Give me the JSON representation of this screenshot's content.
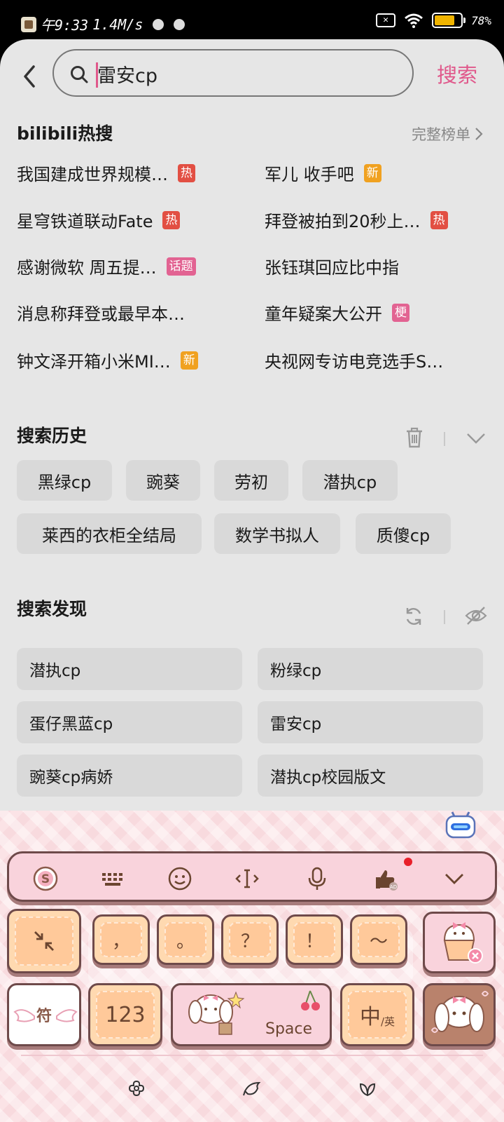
{
  "status_bar": {
    "time": "午9:33",
    "speed": "1.4M/s",
    "battery": "78%",
    "battery_level": 0.78
  },
  "header": {
    "back_icon": "back-arrow-icon",
    "search_icon": "search-icon",
    "search_value": "雷安cp",
    "search_button": "搜索"
  },
  "hot_search": {
    "title": "bilibili热搜",
    "more_label": "完整榜单",
    "items": [
      {
        "text": "我国建成世界规模…",
        "badge": "热",
        "badge_type": "hot"
      },
      {
        "text": "军儿 收手吧",
        "badge": "新",
        "badge_type": "new"
      },
      {
        "text": "星穹铁道联动Fate",
        "badge": "热",
        "badge_type": "hot"
      },
      {
        "text": "拜登被拍到20秒上…",
        "badge": "热",
        "badge_type": "hot"
      },
      {
        "text": "感谢微软 周五提…",
        "badge": "话题",
        "badge_type": "topic"
      },
      {
        "text": "张钰琪回应比中指",
        "badge": "",
        "badge_type": ""
      },
      {
        "text": "消息称拜登或最早本…",
        "badge": "",
        "badge_type": ""
      },
      {
        "text": "童年疑案大公开",
        "badge": "梗",
        "badge_type": "meme"
      },
      {
        "text": "钟文泽开箱小米MI…",
        "badge": "新",
        "badge_type": "new"
      },
      {
        "text": "央视网专访电竞选手S…",
        "badge": "",
        "badge_type": ""
      }
    ]
  },
  "history": {
    "title": "搜索历史",
    "delete_icon": "trash-icon",
    "collapse_icon": "chevron-down-icon",
    "items": [
      "黑绿cp",
      "豌葵",
      "劳初",
      "潜执cp",
      "莱西的衣柜全结局",
      "数学书拟人",
      "质傻cp"
    ]
  },
  "discover": {
    "title": "搜索发现",
    "refresh_icon": "refresh-icon",
    "hide_icon": "eye-off-icon",
    "items": [
      "潜执cp",
      "粉绿cp",
      "蛋仔黑蓝cp",
      "雷安cp",
      "豌葵cp病娇",
      "潜执cp校园版文"
    ]
  },
  "keyboard": {
    "toolbar_icons": [
      "sogou-logo-icon",
      "keyboard-grid-icon",
      "emoji-icon",
      "text-cursor-icon",
      "microphone-icon",
      "thumbs-up-ad-icon",
      "chevron-down-icon"
    ],
    "collapse_key_icon": "collapse-arrows-icon",
    "punctuation": [
      "，",
      "。",
      "？",
      "！",
      "～"
    ],
    "delete_key_icon": "cupcake-delete-icon",
    "symbol_key": "符",
    "number_key": "123",
    "space_key": "Space",
    "lang_key_main": "中",
    "lang_key_sub": "/英",
    "skin_key_icon": "puppy-skin-icon",
    "nav_icons": [
      "flower-icon",
      "bird-icon",
      "leaf-icon"
    ]
  },
  "colors": {
    "accent": "#e0588b",
    "badge_hot": "#e24f43",
    "badge_new": "#f0a120",
    "badge_topic": "#e26392",
    "sheet_bg": "#e6e6e6",
    "chip_bg": "#d9d9d9",
    "keyboard_bg": "#fbe3e6"
  }
}
